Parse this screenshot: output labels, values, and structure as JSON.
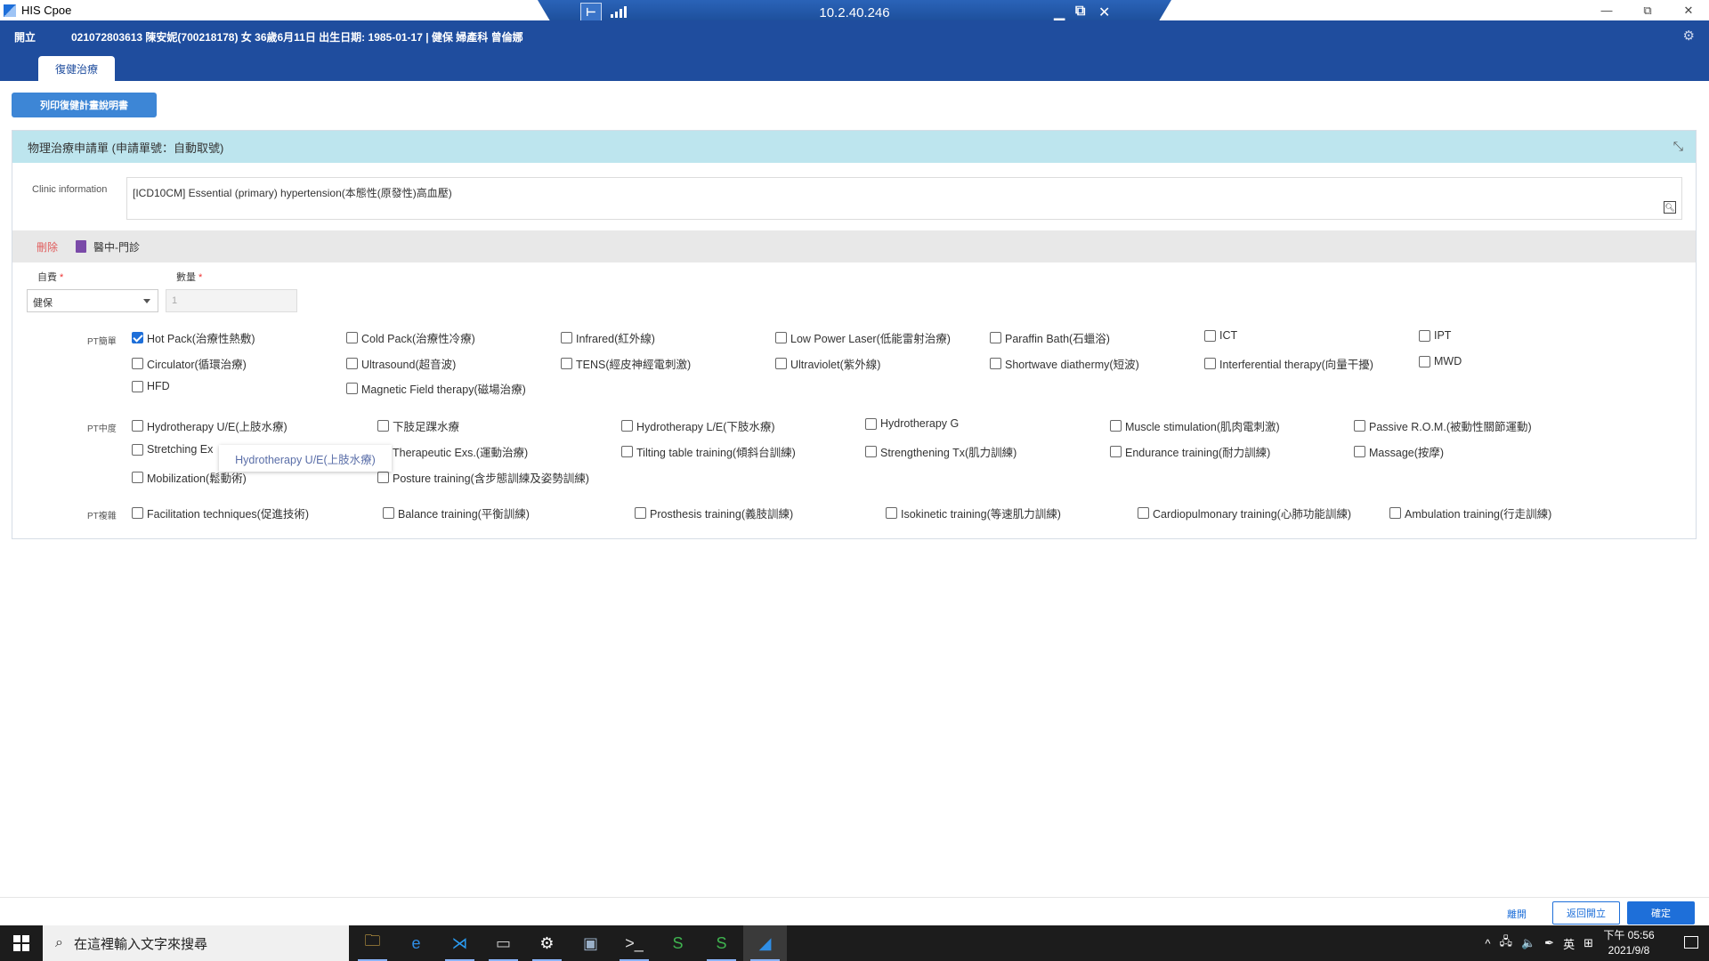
{
  "window": {
    "title": "HIS Cpoe",
    "controls": [
      "—",
      "⧉",
      "✕"
    ]
  },
  "rdp": {
    "ip": "10.2.40.246"
  },
  "header": {
    "hospital": "開立",
    "patient_info": "021072803613  陳安妮(700218178)  女  36歲6月11日  出生日期: 1985-01-17  |  健保  婦產科  曾倫娜",
    "tab": "復健治療"
  },
  "print_button": "列印復健計畫說明書",
  "panel": {
    "title": "物理治療申請單 (申請單號：自動取號)",
    "clinic_label": "Clinic information",
    "clinic_value": "[ICD10CM] Essential (primary) hypertension(本態性(原發性)高血壓)",
    "delete_label": "刪除",
    "dept_label": "醫中-門診",
    "fee_label": "自費",
    "fee_value": "健保",
    "qty_label": "數量",
    "qty_value": "1"
  },
  "groups": [
    {
      "label": "PT簡單"
    },
    {
      "label": "PT中度"
    },
    {
      "label": "PT複雜"
    }
  ],
  "options": [
    {
      "label": "Hot Pack(治療性熱敷)",
      "checked": true
    },
    {
      "label": "Cold Pack(治療性冷療)",
      "checked": false
    },
    {
      "label": "Infrared(紅外線)",
      "checked": false
    },
    {
      "label": "Low Power Laser(低能雷射治療)",
      "checked": false
    },
    {
      "label": "Paraffin Bath(石蠟浴)",
      "checked": false
    },
    {
      "label": "ICT",
      "checked": false
    },
    {
      "label": "IPT",
      "checked": false
    },
    {
      "label": "Circulator(循環治療)",
      "checked": false
    },
    {
      "label": "Ultrasound(超音波)",
      "checked": false
    },
    {
      "label": "TENS(經皮神經電刺激)",
      "checked": false
    },
    {
      "label": "Ultraviolet(紫外線)",
      "checked": false
    },
    {
      "label": "Shortwave diathermy(短波)",
      "checked": false
    },
    {
      "label": "Interferential therapy(向量干擾)",
      "checked": false
    },
    {
      "label": "MWD",
      "checked": false
    },
    {
      "label": "HFD",
      "checked": false
    },
    {
      "label": "Magnetic Field therapy(磁場治療)",
      "checked": false
    },
    {
      "label": "Hydrotherapy U/E(上肢水療)",
      "checked": false
    },
    {
      "label": "下肢足踝水療",
      "checked": false
    },
    {
      "label": "Hydrotherapy L/E(下肢水療)",
      "checked": false
    },
    {
      "label": "Hydrotherapy G",
      "checked": false
    },
    {
      "label": "Muscle stimulation(肌肉電刺激)",
      "checked": false
    },
    {
      "label": "Passive R.O.M.(被動性關節運動)",
      "checked": false
    },
    {
      "label": "Stretching Ex",
      "checked": false
    },
    {
      "label": "Therapeutic Exs.(運動治療)",
      "checked": false
    },
    {
      "label": "Tilting table training(傾斜台訓練)",
      "checked": false
    },
    {
      "label": "Strengthening Tx(肌力訓練)",
      "checked": false
    },
    {
      "label": "Endurance training(耐力訓練)",
      "checked": false
    },
    {
      "label": "Massage(按摩)",
      "checked": false
    },
    {
      "label": "Mobilization(鬆動術)",
      "checked": false
    },
    {
      "label": "Posture training(含步態訓練及姿勢訓練)",
      "checked": false
    },
    {
      "label": "Facilitation techniques(促進技術)",
      "checked": false
    },
    {
      "label": "Balance training(平衡訓練)",
      "checked": false
    },
    {
      "label": "Prosthesis training(義肢訓練)",
      "checked": false
    },
    {
      "label": "Isokinetic training(等速肌力訓練)",
      "checked": false
    },
    {
      "label": "Cardiopulmonary training(心肺功能訓練)",
      "checked": false
    },
    {
      "label": "Ambulation training(行走訓練)",
      "checked": false
    }
  ],
  "tooltip": "Hydrotherapy U/E(上肢水療)",
  "footer": {
    "leave": "離開",
    "back": "返回開立",
    "ok": "確定"
  },
  "taskbar": {
    "search_placeholder": "在這裡輸入文字來搜尋",
    "apps": [
      {
        "icon": "folder-icon",
        "glyph": "🗀",
        "color": "#f2c14e"
      },
      {
        "icon": "edge-icon",
        "glyph": "e",
        "color": "#2f8ee6"
      },
      {
        "icon": "vscode-icon",
        "glyph": "⋊",
        "color": "#2a9bf0"
      },
      {
        "icon": "terminal-icon",
        "glyph": "▭",
        "color": "#cccccc"
      },
      {
        "icon": "settings-icon",
        "glyph": "⚙",
        "color": "#ffffff"
      },
      {
        "icon": "remote-desktop-icon",
        "glyph": "▣",
        "color": "#9ab0c8"
      },
      {
        "icon": "console-icon",
        "glyph": ">_",
        "color": "#dddddd"
      },
      {
        "icon": "app-s-icon",
        "glyph": "S",
        "color": "#3fb34f"
      },
      {
        "icon": "app-s2-icon",
        "glyph": "S",
        "color": "#3fb34f"
      },
      {
        "icon": "his-cpoe-icon",
        "glyph": "◢",
        "color": "#2f8ee6"
      }
    ],
    "tray": [
      "^",
      "🖧",
      "🔈",
      "✒",
      "英",
      "⊞"
    ],
    "time": "下午 05:56",
    "date": "2021/9/8"
  }
}
